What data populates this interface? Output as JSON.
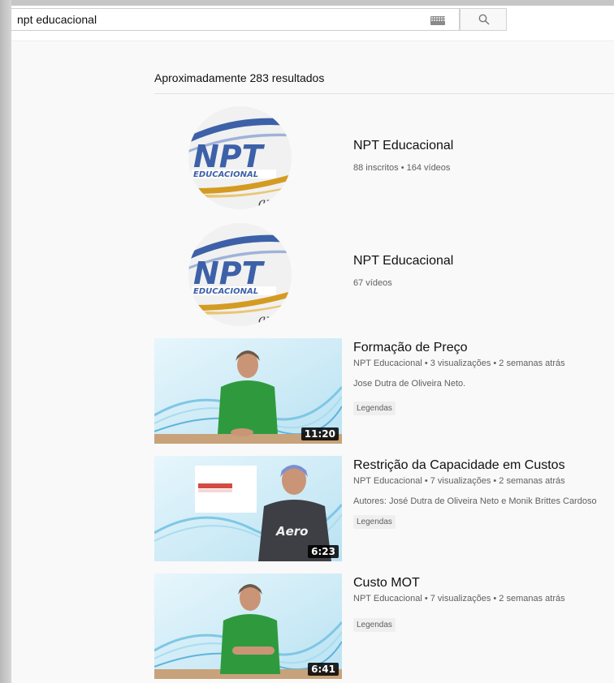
{
  "search": {
    "query": "npt educacional"
  },
  "results": {
    "count_text": "Aproximadamente 283 resultados"
  },
  "channels": [
    {
      "name": "NPT Educacional",
      "meta": "88 inscritos • 164 vídeos",
      "avatar_text": "NPT",
      "avatar_subtext": "EDUCACIONAL"
    },
    {
      "name": "NPT Educacional",
      "meta": "67 vídeos",
      "avatar_text": "NPT",
      "avatar_subtext": "EDUCACIONAL"
    }
  ],
  "videos": [
    {
      "title": "Formação de Preço",
      "meta": "NPT Educacional • 3 visualizações • 2 semanas atrás",
      "description": "Jose Dutra de Oliveira Neto.",
      "badge": "Legendas",
      "duration": "11:20"
    },
    {
      "title": "Restrição da Capacidade em Custos",
      "meta": "NPT Educacional • 7 visualizações • 2 semanas atrás",
      "description": "Autores: José Dutra de Oliveira Neto e Monik Brittes Cardoso",
      "badge": "Legendas",
      "duration": "6:23",
      "shirt_text": "Aero"
    },
    {
      "title": "Custo MOT",
      "meta": "NPT Educacional • 7 visualizações • 2 semanas atrás",
      "description": "",
      "badge": "Legendas",
      "duration": "6:41"
    }
  ],
  "colors": {
    "text": "#111111",
    "secondary_text": "#606060",
    "logo_blue": "#3d61a8",
    "logo_gold": "#d49b22"
  }
}
